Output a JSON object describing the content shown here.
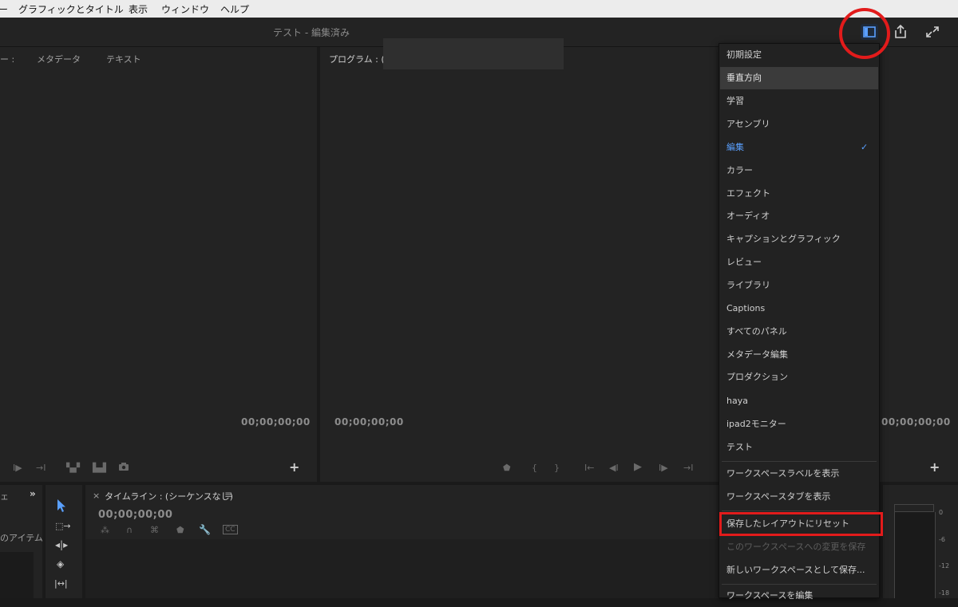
{
  "menubar": {
    "items": [
      "ー",
      "グラフィックとタイトル",
      "表示",
      "ウィンドウ",
      "ヘルプ"
    ]
  },
  "window": {
    "title": "テスト - 編集済み"
  },
  "source_panel": {
    "tab_partial": "ー :",
    "tab_metadata": "メタデータ",
    "tab_text": "テキスト",
    "timecode": "00;00;00;00"
  },
  "program_panel": {
    "tab": "プログラム : (シ",
    "timecode_left": "00;00;00;00",
    "timecode_right": "00;00;00;00"
  },
  "project_panel": {
    "tab_partial": "ェ",
    "items_label": "のアイテム"
  },
  "timeline_panel": {
    "title": "タイムライン : (シーケンスなし)",
    "timecode": "00;00;00;00",
    "close": "×",
    "menu": "≡"
  },
  "workspace_menu": {
    "items": [
      {
        "label": "初期設定",
        "state": "normal"
      },
      {
        "label": "垂直方向",
        "state": "highlighted"
      },
      {
        "label": "学習",
        "state": "normal"
      },
      {
        "label": "アセンブリ",
        "state": "normal"
      },
      {
        "label": "編集",
        "state": "active"
      },
      {
        "label": "カラー",
        "state": "normal"
      },
      {
        "label": "エフェクト",
        "state": "normal"
      },
      {
        "label": "オーディオ",
        "state": "normal"
      },
      {
        "label": "キャプションとグラフィック",
        "state": "normal"
      },
      {
        "label": "レビュー",
        "state": "normal"
      },
      {
        "label": "ライブラリ",
        "state": "normal"
      },
      {
        "label": "Captions",
        "state": "normal"
      },
      {
        "label": "すべてのパネル",
        "state": "normal"
      },
      {
        "label": "メタデータ編集",
        "state": "normal"
      },
      {
        "label": "プロダクション",
        "state": "normal"
      },
      {
        "label": "haya",
        "state": "normal"
      },
      {
        "label": "ipad2モニター",
        "state": "normal"
      },
      {
        "label": "テスト",
        "state": "normal"
      }
    ],
    "actions": [
      {
        "label": "ワークスペースラベルを表示",
        "state": "normal"
      },
      {
        "label": "ワークスペースタブを表示",
        "state": "normal"
      },
      {
        "label": "保存したレイアウトにリセット",
        "state": "normal"
      },
      {
        "label": "このワークスペースへの変更を保存",
        "state": "disabled"
      },
      {
        "label": "新しいワークスペースとして保存...",
        "state": "normal"
      },
      {
        "label": "ワークスペースを編集",
        "state": "normal"
      }
    ],
    "check": "✓"
  },
  "audio_meter": {
    "labels": [
      "0",
      "-6",
      "-12",
      "-18"
    ]
  },
  "colors": {
    "accent_blue": "#5aa0ff",
    "annotation_red": "#e21b1b"
  },
  "icons": [
    "workspace-icon",
    "share-icon",
    "fullscreen-icon",
    "selection-tool-icon",
    "track-select-icon",
    "ripple-edit-icon",
    "razor-icon",
    "slip-icon",
    "wrench-icon",
    "cc-icon",
    "plus-icon",
    "play-icon",
    "camera-icon"
  ]
}
